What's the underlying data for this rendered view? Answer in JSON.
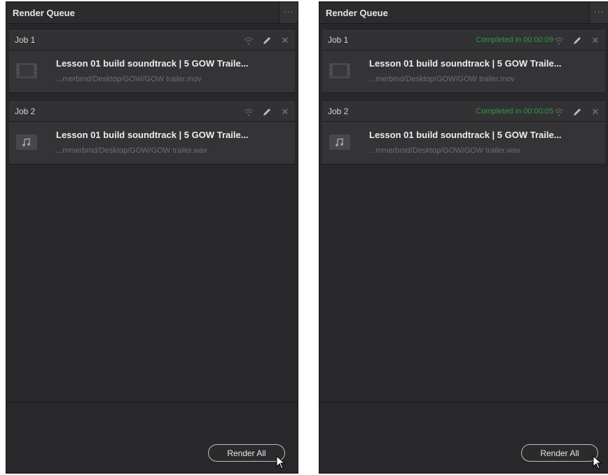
{
  "panels": [
    {
      "title": "Render Queue",
      "options_glyph": "···",
      "jobs": [
        {
          "name": "Job 1",
          "status": "",
          "clip_title": "Lesson 01 build soundtrack | 5 GOW Traile...",
          "path": "...merbmd/Desktop/GOW/GOW trailer.mov",
          "thumb_icon": "film-strip-icon"
        },
        {
          "name": "Job 2",
          "status": "",
          "clip_title": "Lesson 01 build soundtrack | 5 GOW Traile...",
          "path": "...mmerbmd/Desktop/GOW/GOW trailer.wav",
          "thumb_icon": "music-note-icon"
        }
      ],
      "render_all_label": "Render All"
    },
    {
      "title": "Render Queue",
      "options_glyph": "···",
      "jobs": [
        {
          "name": "Job 1",
          "status": "Completed in 00:00:09",
          "clip_title": "Lesson 01 build soundtrack | 5 GOW Traile...",
          "path": "...merbmd/Desktop/GOW/GOW trailer.mov",
          "thumb_icon": "film-strip-icon"
        },
        {
          "name": "Job 2",
          "status": "Completed in 00:00:05",
          "clip_title": "Lesson 01 build soundtrack | 5 GOW Traile...",
          "path": "...mmerbmd/Desktop/GOW/GOW trailer.wav",
          "thumb_icon": "music-note-icon"
        }
      ],
      "render_all_label": "Render All"
    }
  ],
  "colors": {
    "panel_bg": "#282729",
    "status_green": "#2f9a43",
    "text_primary": "#ededed",
    "text_secondary": "#6f6e72"
  }
}
